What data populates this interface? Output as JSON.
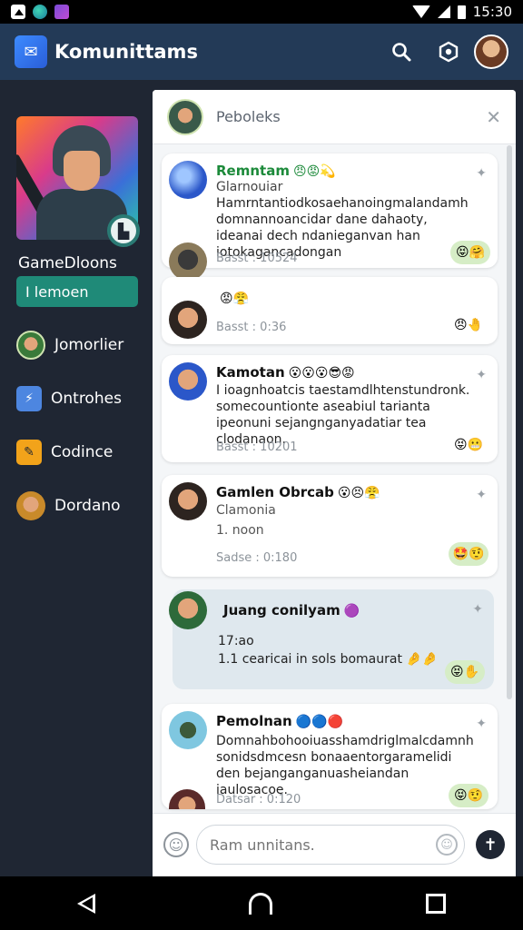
{
  "status_bar": {
    "time": "15:30"
  },
  "header": {
    "title": "Komunittams"
  },
  "sidebar": {
    "game_title": "GameDloons",
    "action_button": "I lemoen",
    "items": [
      {
        "label": "Jomorlier",
        "icon": "soldier-avatar"
      },
      {
        "label": "Ontrohes",
        "icon": "gamepad-icon"
      },
      {
        "label": "Codince",
        "icon": "trophy-icon"
      },
      {
        "label": "Dordano",
        "icon": "user-avatar"
      }
    ]
  },
  "chat": {
    "title": "Peboleks",
    "messages": [
      {
        "name": "Remntam",
        "emojis": "😠😡💫",
        "subtitle": "Glarnouiar",
        "text": "Hamrntantiodkosaehanoingmalandamh domnannoancidar dane dahaoty, ideanai dech ndanieganvan han iotokagancadongan",
        "time": "Basst : 10524",
        "reactions": "😝🤗"
      },
      {
        "name": "",
        "emojis": "😡😤",
        "subtitle": "",
        "text": "",
        "time": "Basst : 0:36",
        "reactions": "😠🤚"
      },
      {
        "name": "Kamotan",
        "emojis": "😮😮😮😎😡",
        "subtitle": "",
        "text": "I ioagnhoatcis taestamdlhtenstundronk. somecountionte aseabiul tarianta ipeonuni sejangnganyadatiar tea clodanaon.",
        "time": "Basst : 10201",
        "reactions": "😝😬"
      },
      {
        "name": "Gamlen Obrcab",
        "emojis": "😮😣😤",
        "subtitle": "Clamonia",
        "text": "1. noon",
        "time": "Sadse : 0:180",
        "reactions": "🤩🤨"
      },
      {
        "name": "Juang conilyam",
        "emojis": "🟣",
        "subtitle": "",
        "text": "17:ao",
        "text2": "1.1 cearicai in sols bomaurat 🤌🤌",
        "time": "",
        "reactions": "😝✋"
      },
      {
        "name": "Pemolnan",
        "emojis": "🔵🔵🔴",
        "subtitle": "",
        "text": "Domnahbohooiuasshamdriglmalcdamnh sonidsdmcesn bonaaentorgaramelidi den bejanganganuasheiandan iaulosacoe.",
        "time": "Datsar : 0:120",
        "reactions": "😝🤨"
      }
    ]
  },
  "composer": {
    "placeholder": "Ram unnitans."
  }
}
